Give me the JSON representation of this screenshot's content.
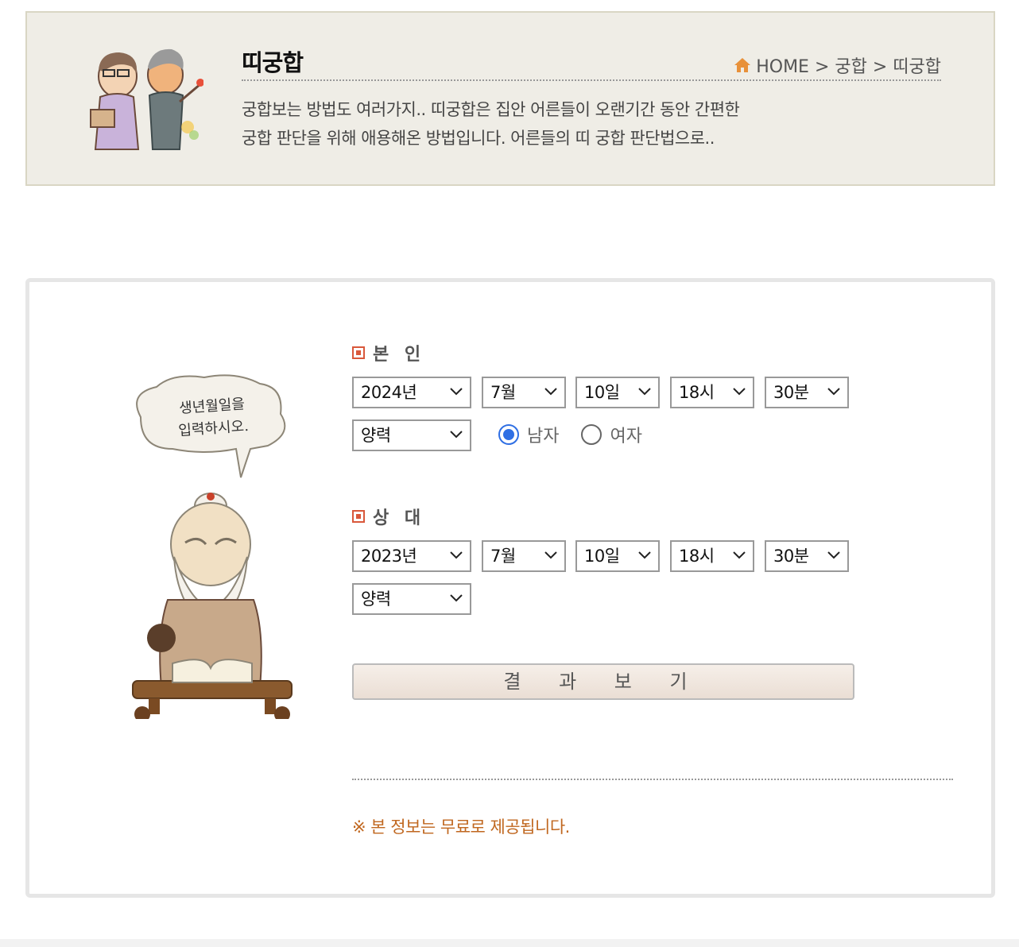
{
  "header": {
    "title": "띠궁합",
    "breadcrumb": "HOME > 궁합 > 띠궁합",
    "home_icon": "home-icon",
    "desc_line1": "궁합보는 방법도 여러가지.. 띠궁합은 집안 어른들이 오랜기간 동안 간편한",
    "desc_line2": "궁합 판단을 위해 애용해온 방법입니다. 어른들의 띠 궁합 판단법으로..",
    "accent_color": "#e8913a"
  },
  "illustration": {
    "speech_line1": "생년월일을",
    "speech_line2": "입력하시오."
  },
  "self": {
    "label": "본 인",
    "year": "2024년",
    "month": "7월",
    "day": "10일",
    "hour": "18시",
    "minute": "30분",
    "calendar": "양력",
    "gender_male": "남자",
    "gender_female": "여자",
    "gender_selected": "남자"
  },
  "partner": {
    "label": "상 대",
    "year": "2023년",
    "month": "7월",
    "day": "10일",
    "hour": "18시",
    "minute": "30분",
    "calendar": "양력"
  },
  "submit_label": "결 과 보 기",
  "free_note": "※ 본 정보는 무료로 제공됩니다.",
  "colors": {
    "marker": "#d9583b",
    "note": "#c0671f",
    "radio_checked": "#2f6fe4"
  }
}
